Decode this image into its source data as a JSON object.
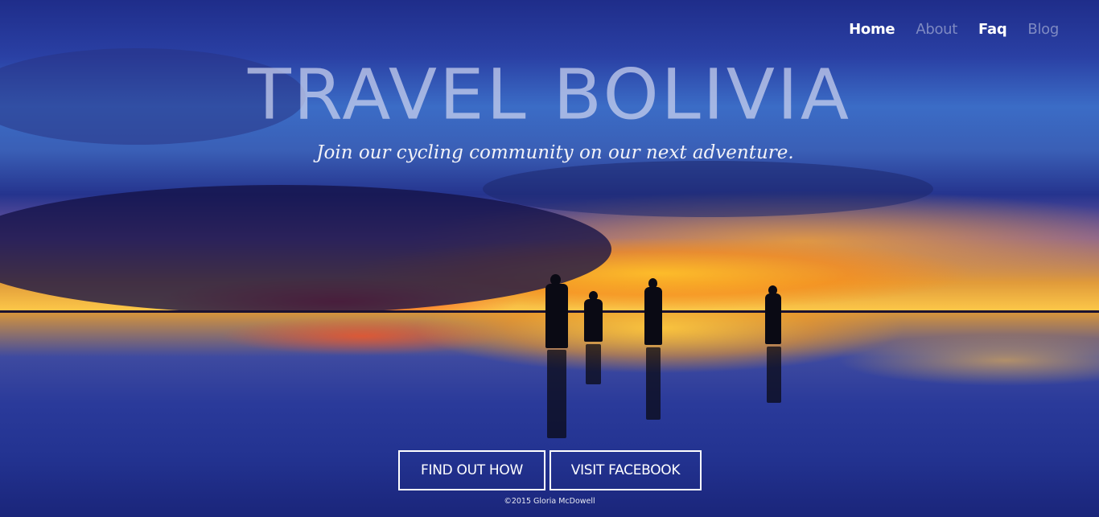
{
  "nav": {
    "items": [
      {
        "label": "Home",
        "state": "active"
      },
      {
        "label": "About",
        "state": "muted"
      },
      {
        "label": "Faq",
        "state": "active"
      },
      {
        "label": "Blog",
        "state": "muted"
      }
    ]
  },
  "hero": {
    "title": "TRAVEL BOLIVIA",
    "subtitle": "Join our cycling community on our next adventure.",
    "background_description_icon": "salt-flat-sunset-photo"
  },
  "buttons": {
    "find_out_how": "FIND OUT HOW",
    "visit_facebook": "VISIT FACEBOOK"
  },
  "footer": {
    "copyright": "©2015 Gloria McDowell"
  },
  "colors": {
    "button_border": "#ffffff",
    "title_color": "#cdd4f0",
    "nav_active": "#ffffff",
    "nav_muted": "#c8cde6"
  }
}
